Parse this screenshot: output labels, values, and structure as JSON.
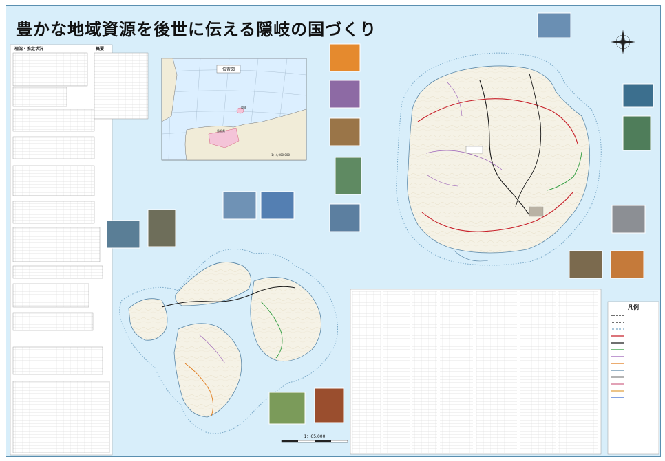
{
  "title": "豊かな地域資源を後世に伝える隠岐の国づくり",
  "stats_panel": {
    "heading_outline": "現況・推定状況",
    "heading_summary": "概要"
  },
  "location_map": {
    "heading": "位置図",
    "scale": "1：4,000,000",
    "places": [
      "隠岐",
      "島根県"
    ]
  },
  "scale_bar": "1：65,000",
  "legend": {
    "heading": "凡例"
  },
  "colors": {
    "sea": "#d8eefa",
    "land": "#f5f2e6",
    "road_national": "#c8202a",
    "road_main": "#1a1a1a",
    "road_prefectural": "#2a9a3a",
    "road_local": "#9a5fb8",
    "road_orange": "#e07a1a",
    "coast_dot": "#7aa9c8"
  }
}
